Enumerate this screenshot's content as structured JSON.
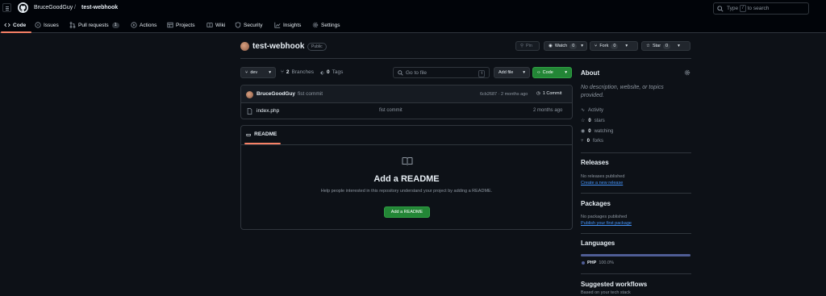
{
  "header": {
    "owner": "BruceGoodGuy",
    "separator": "/",
    "repo": "test-webhook",
    "search_prefix": "Type",
    "search_key": "/",
    "search_suffix": "to search"
  },
  "tabs": [
    {
      "label": "Code"
    },
    {
      "label": "Issues"
    },
    {
      "label": "Pull requests",
      "count": "1"
    },
    {
      "label": "Actions"
    },
    {
      "label": "Projects"
    },
    {
      "label": "Wiki"
    },
    {
      "label": "Security"
    },
    {
      "label": "Insights"
    },
    {
      "label": "Settings"
    }
  ],
  "repo": {
    "name": "test-webhook",
    "visibility": "Public",
    "pin_label": "Pin",
    "watch_label": "Watch",
    "watch_count": "0",
    "fork_label": "Fork",
    "fork_count": "0",
    "star_label": "Star",
    "star_count": "0"
  },
  "toolbar": {
    "branch": "dev",
    "branches_count": "2",
    "branches_label": "Branches",
    "tags_count": "0",
    "tags_label": "Tags",
    "goto_placeholder": "Go to file",
    "goto_key": "t",
    "add_file": "Add file",
    "code_button": "Code"
  },
  "commit": {
    "author": "BruceGoodGuy",
    "message": "fist commit",
    "meta": "6cb2687 · 2 months ago",
    "commits_label": "1 Commit"
  },
  "files": [
    {
      "name": "index.php",
      "message": "fist commit",
      "age": "2 months ago"
    }
  ],
  "readme": {
    "tab_label": "README",
    "title": "Add a README",
    "description": "Help people interested in this repository understand your project by adding a README.",
    "button": "Add a README"
  },
  "about": {
    "heading": "About",
    "description": "No description, website, or topics provided.",
    "activity": "Activity",
    "stars_count": "0",
    "stars_label": "stars",
    "watching_count": "0",
    "watching_label": "watching",
    "forks_count": "0",
    "forks_label": "forks"
  },
  "releases": {
    "heading": "Releases",
    "text": "No releases published",
    "link": "Create a new release"
  },
  "packages": {
    "heading": "Packages",
    "text": "No packages published",
    "link": "Publish your first package"
  },
  "languages": {
    "heading": "Languages",
    "items": [
      {
        "name": "PHP",
        "percent": "100.0%",
        "share": 1.0,
        "color": "#4F5D95"
      }
    ]
  },
  "workflows": {
    "heading": "Suggested workflows",
    "subtext": "Based on your tech stack"
  },
  "colors": {
    "accent_tab": "#f78166",
    "green_button": "#238636",
    "link": "#4493f8",
    "php": "#4F5D95"
  }
}
